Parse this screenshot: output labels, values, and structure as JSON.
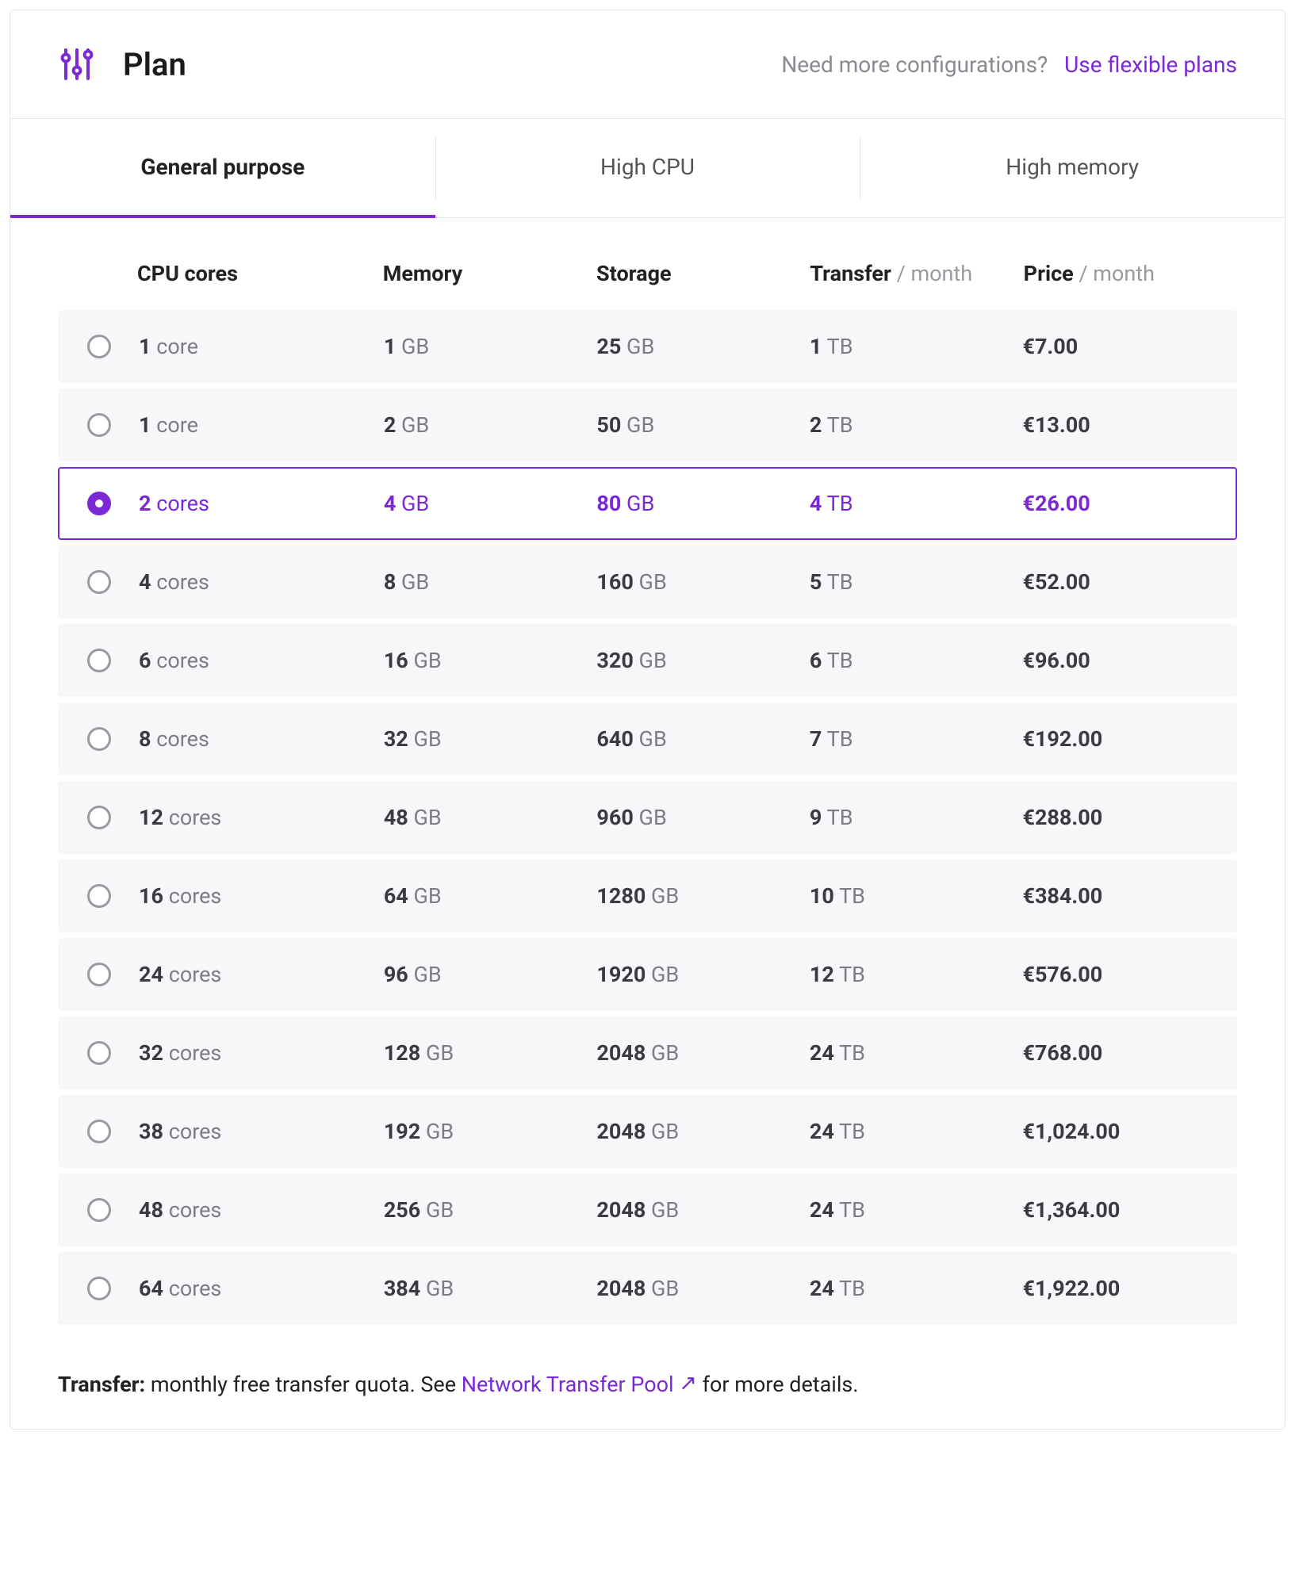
{
  "header": {
    "title": "Plan",
    "icon": "settings-sliders-icon",
    "prompt": "Need more configurations?",
    "cta": "Use flexible plans"
  },
  "tabs": [
    {
      "label": "General purpose",
      "active": true
    },
    {
      "label": "High CPU",
      "active": false
    },
    {
      "label": "High memory",
      "active": false
    }
  ],
  "columns": {
    "cpu": "CPU cores",
    "memory": "Memory",
    "storage": "Storage",
    "transfer": "Transfer",
    "transfer_suffix": " / month",
    "price": "Price",
    "price_suffix": " / month"
  },
  "selected_index": 2,
  "plans": [
    {
      "cpu_n": "1",
      "cpu_u": "core",
      "mem_n": "1",
      "mem_u": "GB",
      "sto_n": "25",
      "sto_u": "GB",
      "tx_n": "1",
      "tx_u": "TB",
      "price": "€7.00"
    },
    {
      "cpu_n": "1",
      "cpu_u": "core",
      "mem_n": "2",
      "mem_u": "GB",
      "sto_n": "50",
      "sto_u": "GB",
      "tx_n": "2",
      "tx_u": "TB",
      "price": "€13.00"
    },
    {
      "cpu_n": "2",
      "cpu_u": "cores",
      "mem_n": "4",
      "mem_u": "GB",
      "sto_n": "80",
      "sto_u": "GB",
      "tx_n": "4",
      "tx_u": "TB",
      "price": "€26.00"
    },
    {
      "cpu_n": "4",
      "cpu_u": "cores",
      "mem_n": "8",
      "mem_u": "GB",
      "sto_n": "160",
      "sto_u": "GB",
      "tx_n": "5",
      "tx_u": "TB",
      "price": "€52.00"
    },
    {
      "cpu_n": "6",
      "cpu_u": "cores",
      "mem_n": "16",
      "mem_u": "GB",
      "sto_n": "320",
      "sto_u": "GB",
      "tx_n": "6",
      "tx_u": "TB",
      "price": "€96.00"
    },
    {
      "cpu_n": "8",
      "cpu_u": "cores",
      "mem_n": "32",
      "mem_u": "GB",
      "sto_n": "640",
      "sto_u": "GB",
      "tx_n": "7",
      "tx_u": "TB",
      "price": "€192.00"
    },
    {
      "cpu_n": "12",
      "cpu_u": "cores",
      "mem_n": "48",
      "mem_u": "GB",
      "sto_n": "960",
      "sto_u": "GB",
      "tx_n": "9",
      "tx_u": "TB",
      "price": "€288.00"
    },
    {
      "cpu_n": "16",
      "cpu_u": "cores",
      "mem_n": "64",
      "mem_u": "GB",
      "sto_n": "1280",
      "sto_u": "GB",
      "tx_n": "10",
      "tx_u": "TB",
      "price": "€384.00"
    },
    {
      "cpu_n": "24",
      "cpu_u": "cores",
      "mem_n": "96",
      "mem_u": "GB",
      "sto_n": "1920",
      "sto_u": "GB",
      "tx_n": "12",
      "tx_u": "TB",
      "price": "€576.00"
    },
    {
      "cpu_n": "32",
      "cpu_u": "cores",
      "mem_n": "128",
      "mem_u": "GB",
      "sto_n": "2048",
      "sto_u": "GB",
      "tx_n": "24",
      "tx_u": "TB",
      "price": "€768.00"
    },
    {
      "cpu_n": "38",
      "cpu_u": "cores",
      "mem_n": "192",
      "mem_u": "GB",
      "sto_n": "2048",
      "sto_u": "GB",
      "tx_n": "24",
      "tx_u": "TB",
      "price": "€1,024.00"
    },
    {
      "cpu_n": "48",
      "cpu_u": "cores",
      "mem_n": "256",
      "mem_u": "GB",
      "sto_n": "2048",
      "sto_u": "GB",
      "tx_n": "24",
      "tx_u": "TB",
      "price": "€1,364.00"
    },
    {
      "cpu_n": "64",
      "cpu_u": "cores",
      "mem_n": "384",
      "mem_u": "GB",
      "sto_n": "2048",
      "sto_u": "GB",
      "tx_n": "24",
      "tx_u": "TB",
      "price": "€1,922.00"
    }
  ],
  "footer": {
    "label": "Transfer:",
    "text_before": " monthly free transfer quota. See ",
    "link": "Network Transfer Pool",
    "text_after": " for more details."
  }
}
